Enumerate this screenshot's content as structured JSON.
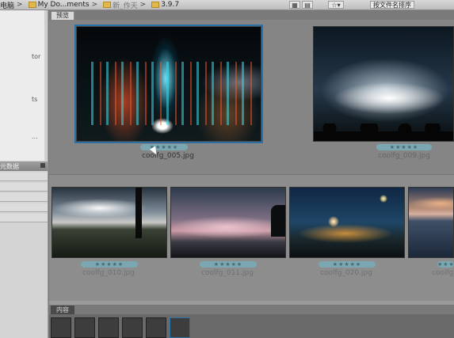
{
  "breadcrumb": {
    "items": [
      {
        "label": "电脑",
        "style": "normal"
      },
      {
        "label": "My Do...ments",
        "style": "normal"
      },
      {
        "label": "新_作天",
        "style": "dim"
      },
      {
        "label": "3.9.7",
        "style": "normal"
      }
    ],
    "separator": ">"
  },
  "toolbar": {
    "sort_label": "按文件名排序",
    "view_icon": "grid-view-icon",
    "list_icon": "list-view-icon",
    "star_icon": "star-filter-icon"
  },
  "left_panel": {
    "favorites": [
      "tor",
      "ts",
      "..."
    ],
    "metadata_tab_label": "元数据",
    "metadata_rows": 5
  },
  "preview": {
    "tab_label": "预览",
    "items": [
      {
        "filename": "coolfg_005.jpg",
        "rating": "★★★★★",
        "selected": true
      },
      {
        "filename": "coolfg_009.jpg",
        "rating": "★★★★★",
        "selected": false
      }
    ]
  },
  "thumbnails": {
    "items": [
      {
        "filename": "coolfg_010.jpg",
        "rating": "★★★★★"
      },
      {
        "filename": "coolfg_011.jpg",
        "rating": "★★★★★"
      },
      {
        "filename": "coolfg_020.jpg",
        "rating": "★★★★★"
      },
      {
        "filename": "coolfg_0",
        "rating": "★★★★★"
      }
    ]
  },
  "content_panel": {
    "tab_label": "内容",
    "thumb_count": 6
  },
  "colors": {
    "selection": "#2b6fa3",
    "rating_badge": "#7aa7b1",
    "pane_bg": "#858585"
  }
}
